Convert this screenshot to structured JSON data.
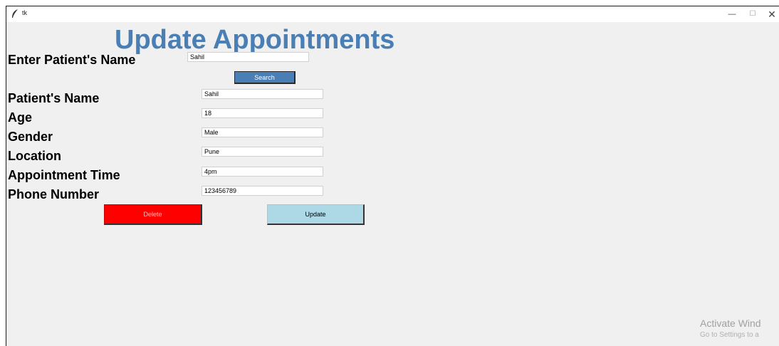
{
  "window": {
    "title": "tk"
  },
  "page": {
    "heading": "Update Appointments"
  },
  "search": {
    "label": "Enter Patient's Name",
    "value": "Sahil",
    "button_label": "Search"
  },
  "form": {
    "name_label": "Patient's Name",
    "name_value": "Sahil",
    "age_label": "Age",
    "age_value": "18",
    "gender_label": "Gender",
    "gender_value": "Male",
    "location_label": "Location",
    "location_value": "Pune",
    "time_label": "Appointment Time",
    "time_value": "4pm",
    "phone_label": "Phone Number",
    "phone_value": "123456789"
  },
  "actions": {
    "delete_label": "Delete",
    "update_label": "Update"
  },
  "watermark": {
    "line1": "Activate Wind",
    "line2": "Go to Settings to a"
  },
  "colors": {
    "heading": "#4a7fb5",
    "search_button": "#4a7fb5",
    "delete_button": "#ff0000",
    "update_button": "#add8e6",
    "background": "#f0f0f0"
  },
  "icons": {
    "app": "feather-icon",
    "minimize": "minimize-icon",
    "maximize": "maximize-icon",
    "close": "close-icon"
  }
}
